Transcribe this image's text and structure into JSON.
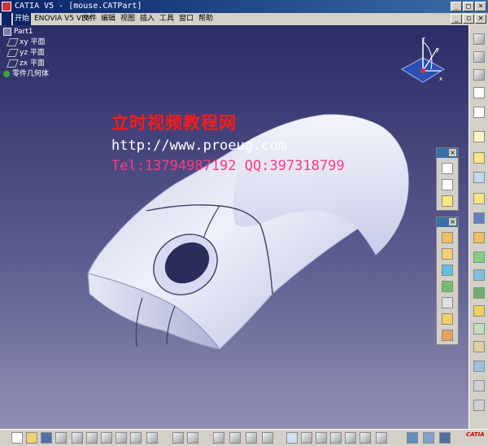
{
  "window": {
    "title": "CATIA V5 - [mouse.CATPart]"
  },
  "menu": {
    "items": [
      "开始",
      "ENOVIA V5 VPM",
      "文件",
      "编辑",
      "视图",
      "插入",
      "工具",
      "窗口",
      "帮助"
    ],
    "active": "开始"
  },
  "tree": {
    "root": "Part1",
    "planes": [
      "xy 平面",
      "yz 平面",
      "zx 平面"
    ],
    "body": "零件几何体"
  },
  "watermark": {
    "line1": "立时视频教程网",
    "line2": "http://www.proeug.com",
    "line3": "Tel:13794987192  QQ:397318799"
  },
  "axis": {
    "x": "x",
    "y": "y",
    "z": "z"
  },
  "colors": {
    "title_bar": "#0a246a",
    "viewport_top": "#2c2c66",
    "viewport_bottom": "#8f8fb4",
    "watermark_red": "#ff1a1a",
    "watermark_pink": "#ff3b7f",
    "model_surface": "#e6e8f6"
  },
  "icons": {
    "right_toolbar": [
      "view-tool-icon",
      "hide-icon",
      "fly-icon",
      "select-arrow-icon",
      "sketch-icon",
      "plane-sketch-icon",
      "positioned-sketch-icon",
      "pad-icon",
      "pocket-icon",
      "shaft-icon",
      "rib-icon",
      "hole-icon",
      "draft-icon",
      "shell-icon",
      "thickness-icon",
      "split-icon",
      "fillet-icon",
      "chamfer-icon",
      "measure-icon",
      "apply-material-icon",
      "render-icon"
    ],
    "bottom_toolbar": [
      "new-file-icon",
      "open-icon",
      "save-icon",
      "print-icon",
      "cut-icon",
      "copy-icon",
      "paste-icon",
      "undo-icon",
      "redo-icon",
      "whats-this-icon",
      "formula-icon",
      "comment-icon",
      "catalog-icon",
      "lock-icon",
      "update-icon",
      "fit-all-icon",
      "pan-icon",
      "rotate-icon",
      "zoom-in-icon",
      "zoom-out-icon",
      "normal-view-icon",
      "isometric-view-icon",
      "shading-icon",
      "hide-show-icon",
      "swap-icon"
    ]
  },
  "logo": "CATIA"
}
